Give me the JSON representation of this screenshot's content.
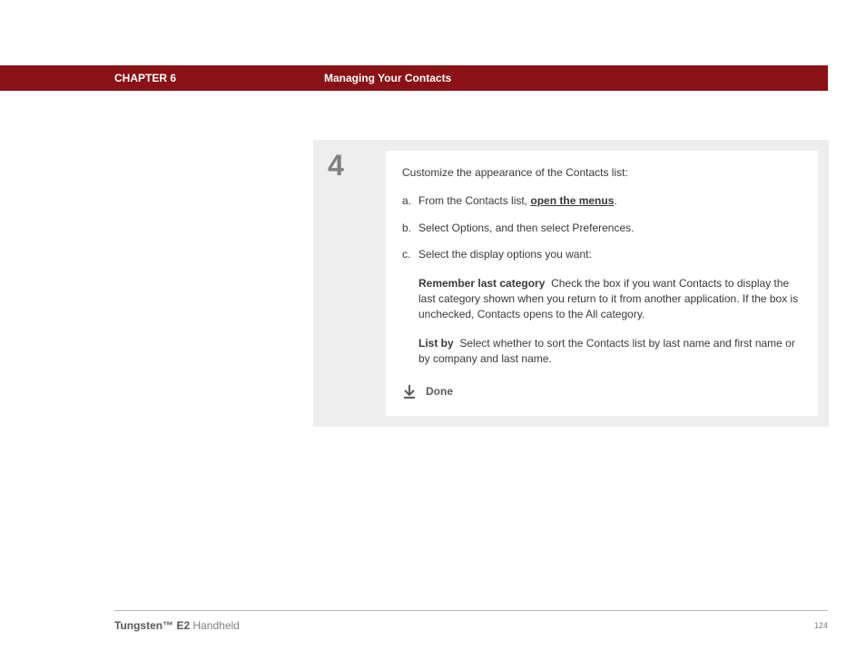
{
  "header": {
    "chapter": "CHAPTER 6",
    "title": "Managing Your Contacts"
  },
  "step": {
    "number": "4",
    "intro": "Customize the appearance of the Contacts list:",
    "items": {
      "a": {
        "marker": "a.",
        "prefix": "From the Contacts list, ",
        "link": "open the menus",
        "suffix": "."
      },
      "b": {
        "marker": "b.",
        "text": "Select Options, and then select Preferences."
      },
      "c": {
        "marker": "c.",
        "text": "Select the display options you want:"
      }
    },
    "options": {
      "remember": {
        "label": "Remember last category",
        "text": "Check the box if you want Contacts to display the last category shown when you return to it from another application. If the box is unchecked, Contacts opens to the All category."
      },
      "listby": {
        "label": "List by",
        "text": "Select whether to sort the Contacts list by last name and first name or by company and last name."
      }
    },
    "done": "Done"
  },
  "footer": {
    "product_bold": "Tungsten™ E2",
    "product_rest": " Handheld",
    "page": "124"
  }
}
